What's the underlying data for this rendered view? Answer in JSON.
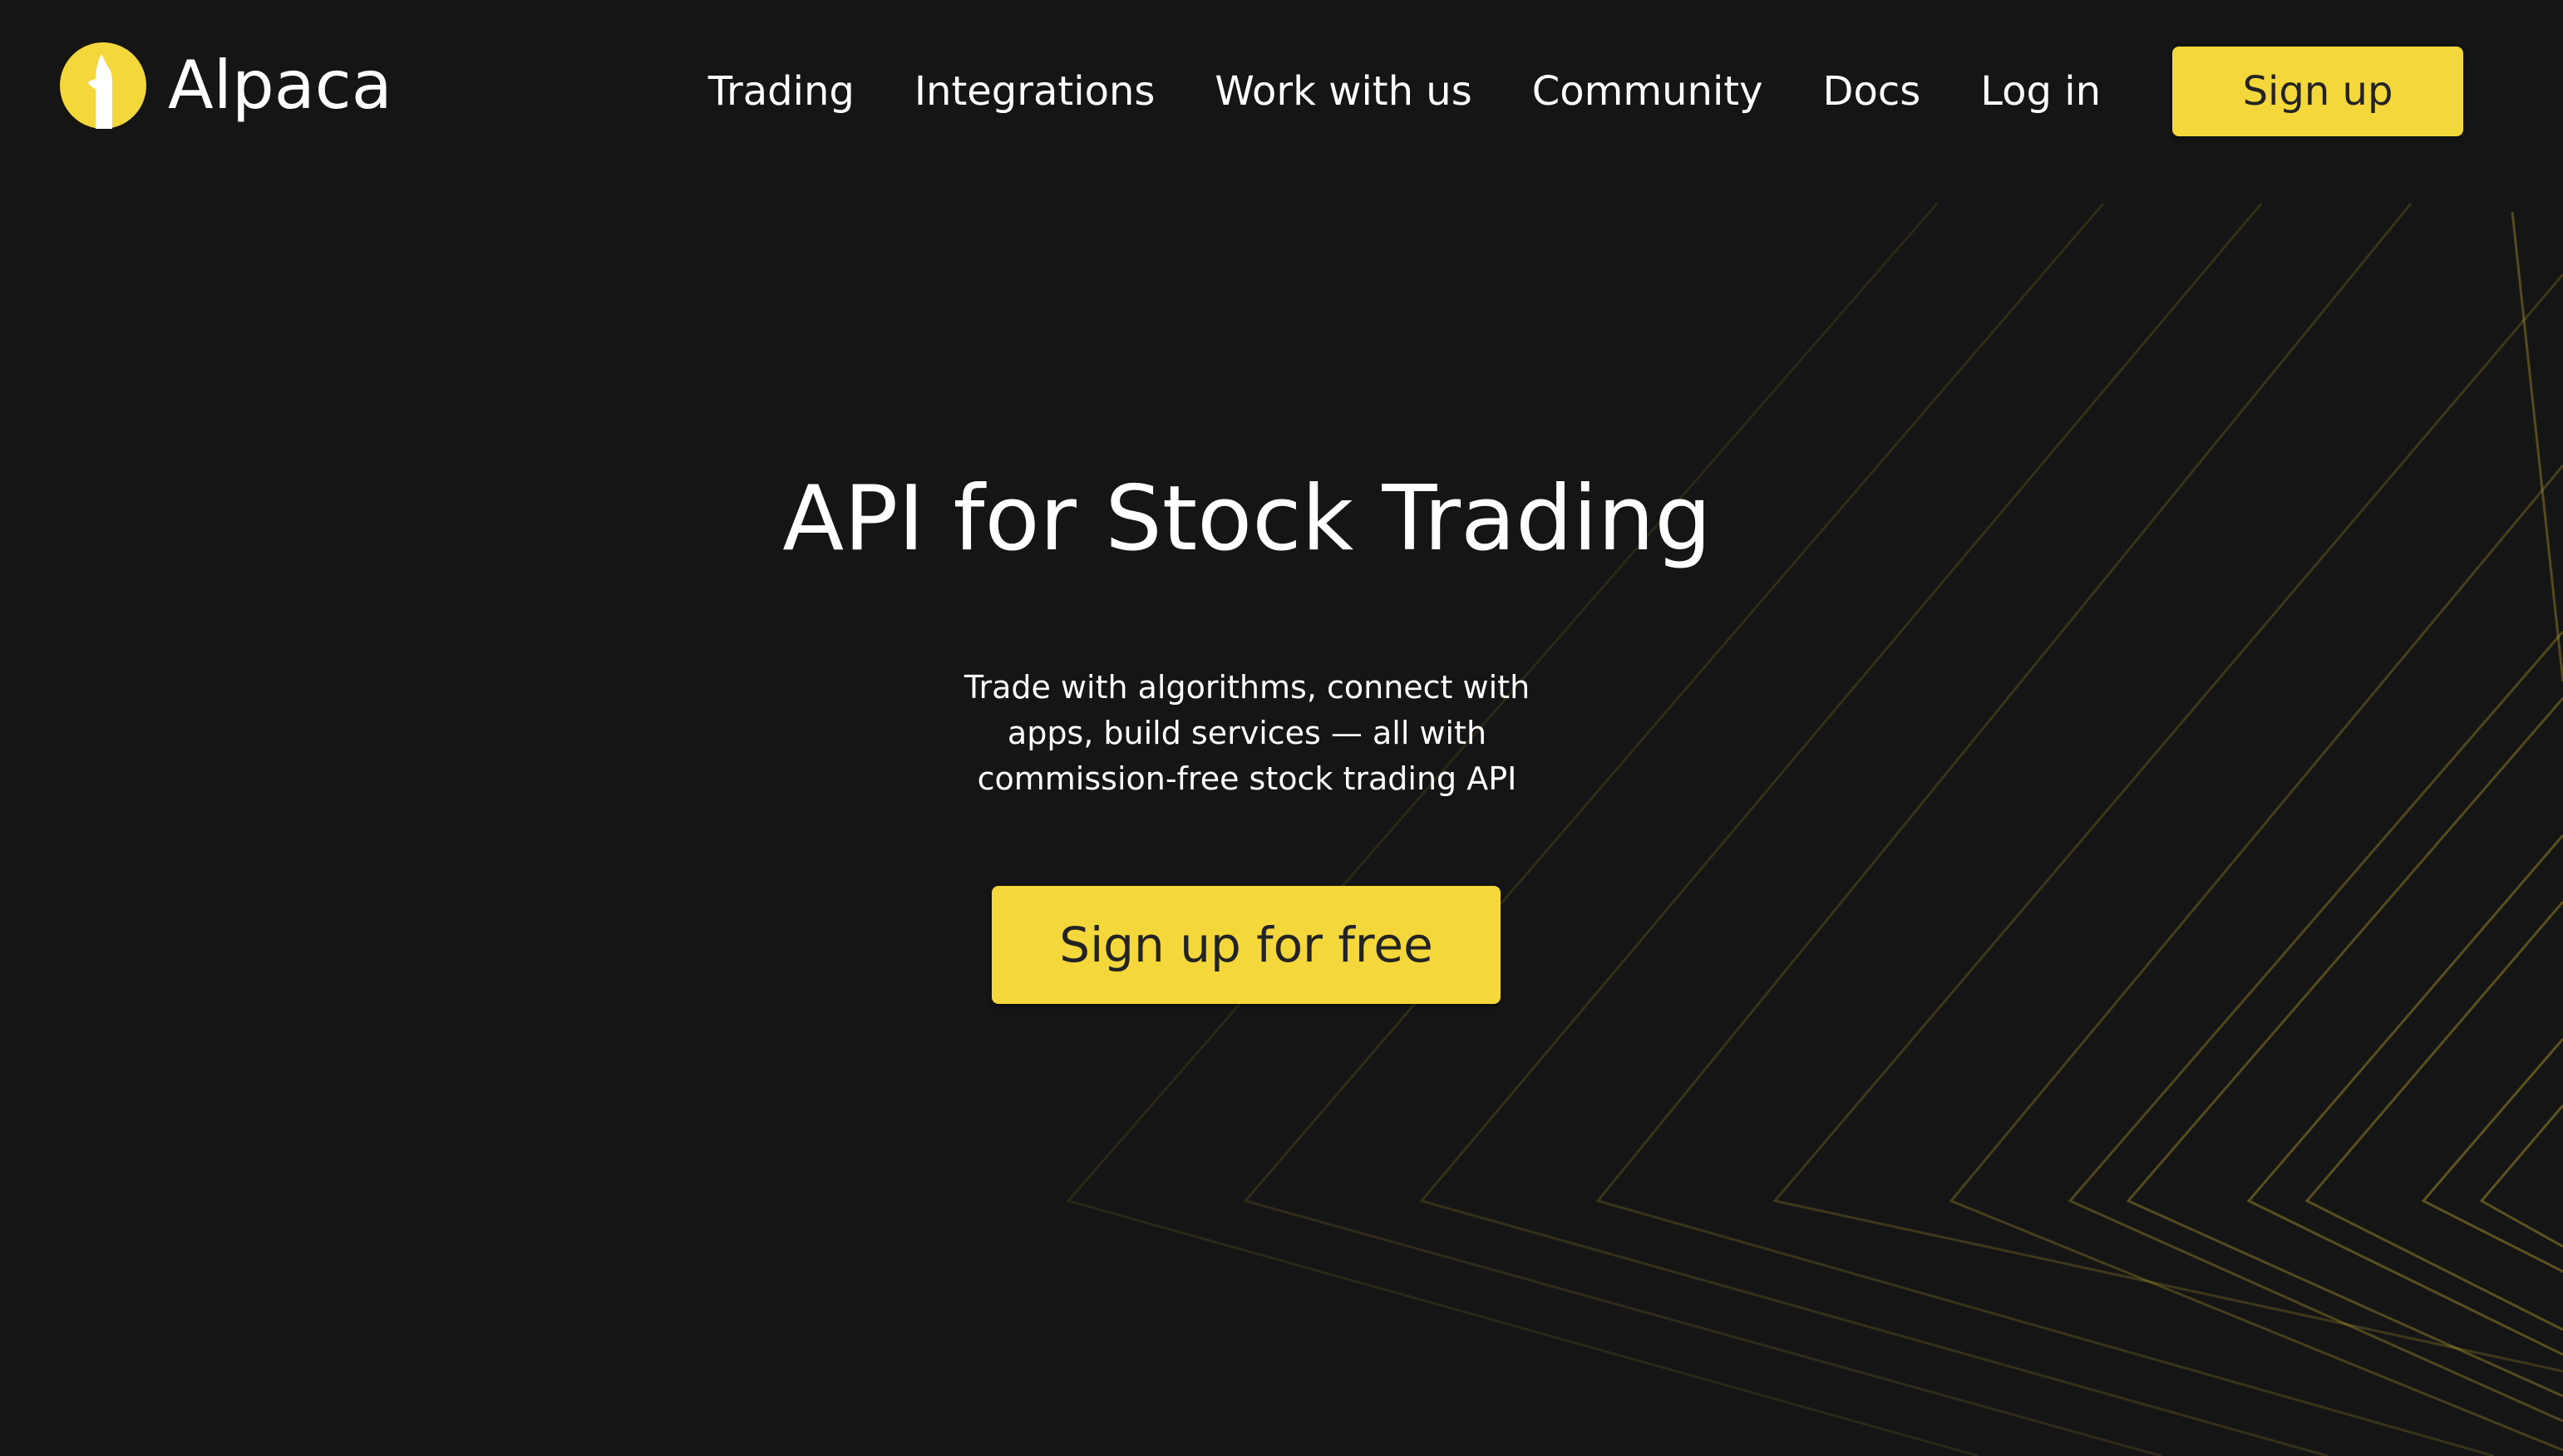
{
  "brand": {
    "name": "Alpaca",
    "accent_color": "#f4d73a",
    "background_color": "#151515",
    "logo_icon": "alpaca-logo-icon"
  },
  "nav": {
    "items": [
      {
        "label": "Trading"
      },
      {
        "label": "Integrations"
      },
      {
        "label": "Work with us"
      },
      {
        "label": "Community"
      },
      {
        "label": "Docs"
      },
      {
        "label": "Log in"
      }
    ],
    "signup_label": "Sign up"
  },
  "hero": {
    "title": "API for Stock Trading",
    "subtitle": "Trade with algorithms, connect with apps, build services — all with commission-free stock trading API",
    "cta_label": "Sign up for free"
  }
}
